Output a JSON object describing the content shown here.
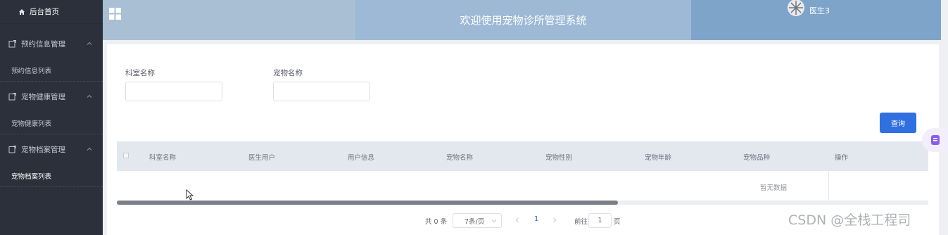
{
  "sidebar": {
    "home": "后台首页",
    "groups": [
      {
        "label": "预约信息管理",
        "sub": "预约信息列表"
      },
      {
        "label": "宠物健康管理",
        "sub": "宠物健康列表"
      },
      {
        "label": "宠物档案管理",
        "sub": "宠物档案列表"
      }
    ]
  },
  "header": {
    "title": "欢迎使用宠物诊所管理系统",
    "user": "医生3"
  },
  "search": {
    "dept_label": "科室名称",
    "pet_label": "宠物名称",
    "query_button": "查询"
  },
  "table": {
    "columns": [
      "科室名称",
      "医生用户",
      "用户信息",
      "宠物名称",
      "宠物性别",
      "宠物年龄",
      "宠物品种",
      "操作"
    ],
    "empty_text": "暂无数据"
  },
  "pagination": {
    "total": "共 0 条",
    "page_size": "7条/页",
    "current_page": "1",
    "goto_label": "前往",
    "goto_value": "1",
    "page_suffix": "页"
  },
  "watermark": "CSDN @全栈工程司",
  "colors": {
    "sidebar_bg": "#2b303b",
    "header_mid": "#9db9d6",
    "header_right": "#7fa4c9",
    "primary": "#2f6fe0"
  },
  "icons": [
    "home-icon",
    "grid-icon",
    "avatar-icon",
    "menu-doc-icon",
    "chevron-up-icon",
    "chevron-left-icon",
    "chevron-right-icon",
    "mouse-cursor-icon"
  ]
}
